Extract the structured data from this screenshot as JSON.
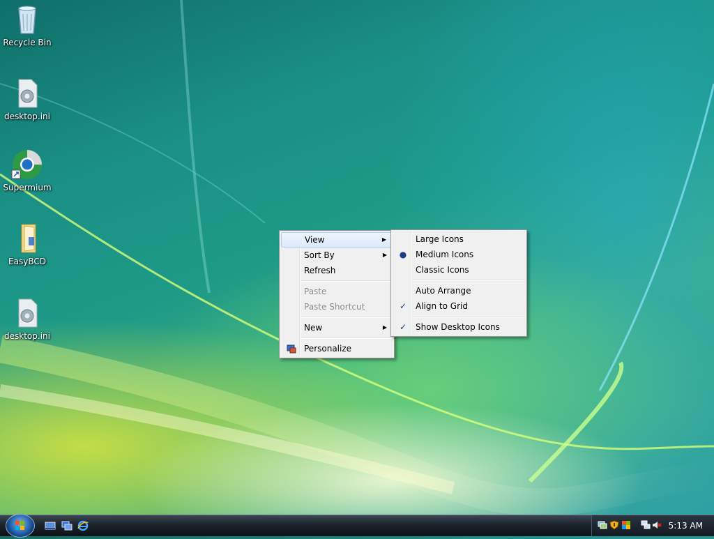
{
  "desktop": {
    "icons": [
      {
        "label": "Recycle Bin"
      },
      {
        "label": "desktop.ini"
      },
      {
        "label": "Supermium"
      },
      {
        "label": "EasyBCD"
      },
      {
        "label": "desktop.ini"
      }
    ]
  },
  "context_menu": {
    "items": [
      {
        "label": "View"
      },
      {
        "label": "Sort By"
      },
      {
        "label": "Refresh"
      },
      {
        "label": "Paste"
      },
      {
        "label": "Paste Shortcut"
      },
      {
        "label": "New"
      },
      {
        "label": "Personalize"
      }
    ]
  },
  "view_submenu": {
    "items": [
      {
        "label": "Large Icons"
      },
      {
        "label": "Medium Icons",
        "selected": true
      },
      {
        "label": "Classic Icons"
      },
      {
        "label": "Auto Arrange"
      },
      {
        "label": "Align to Grid",
        "checked": true
      },
      {
        "label": "Show Desktop Icons",
        "checked": true
      }
    ]
  },
  "taskbar": {
    "clock": "5:13 AM"
  }
}
